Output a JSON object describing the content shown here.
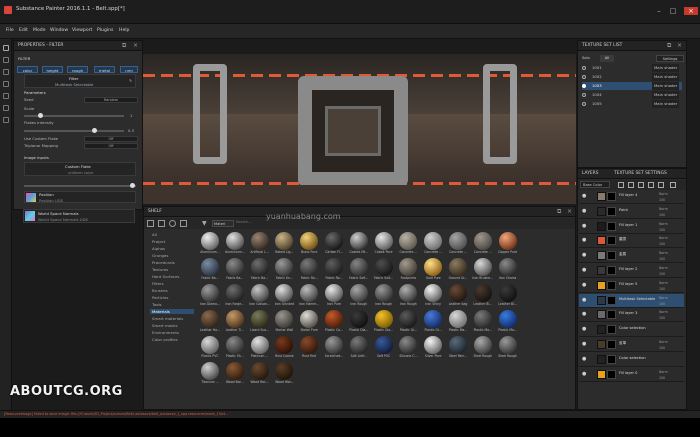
{
  "app": {
    "window_title": "Substance Painter 2016.1.1 - Belt.spp[*]",
    "menu": [
      "File",
      "Edit",
      "Mode",
      "Window",
      "Viewport",
      "Plugins",
      "Help"
    ]
  },
  "properties": {
    "panel_title": "PROPERTIES - FILTER",
    "section_filter": "FILTER",
    "channel_tags": [
      "color",
      "height",
      "rough",
      "metal",
      "nrm"
    ],
    "filter_label": "Filter",
    "filter_name": "Multitask Selectable",
    "parameters_header": "Parameters",
    "seed_label": "Seed",
    "seed_value": "Random",
    "scale_label": "Scale",
    "scale_value": "1",
    "flakes_label": "Flakes Intensity",
    "flakes_value": "0.3",
    "use_custom_flake_label": "Use Custom Flake",
    "use_custom_flake_value": "Off",
    "triplanar_label": "Triplanar Mapping",
    "triplanar_value": "Off",
    "image_inputs_header": "Image inputs",
    "custom_flake_title": "Custom Flake",
    "custom_flake_sub": "uniform color",
    "position_title": "Position",
    "position_sub": "Position UDS",
    "world_normals_title": "World Space Normals",
    "world_normals_sub": "World Space Normals UDS"
  },
  "shelf": {
    "panel_title": "SHELF",
    "search_placeholder": "Search...",
    "filter_chip": "Materi",
    "categories": [
      "All",
      "Project",
      "Alphas",
      "Grunges",
      "Procedurals",
      "Textures",
      "Hard Surfaces",
      "Filters",
      "Brushes",
      "Particles",
      "Tools",
      "Materials",
      "Smart materials",
      "Smart masks",
      "Environments",
      "Color profiles"
    ],
    "selected_category": "Materials",
    "materials": [
      {
        "name": "Aluminium...",
        "c1": "#f0f0f0",
        "c2": "#5a5a5a"
      },
      {
        "name": "Aluminium...",
        "c1": "#e2e2e2",
        "c2": "#4a4a4a"
      },
      {
        "name": "Artificial L...",
        "c1": "#9a8470",
        "c2": "#2e241d"
      },
      {
        "name": "Baked Lig...",
        "c1": "#c9b58a",
        "c2": "#4a3c25"
      },
      {
        "name": "Brass Pure",
        "c1": "#f4d27a",
        "c2": "#6a4a12"
      },
      {
        "name": "Carbon Fi...",
        "c1": "#6a6a6a",
        "c2": "#121212"
      },
      {
        "name": "Coated Mt...",
        "c1": "#cfcfcf",
        "c2": "#2c2c2c"
      },
      {
        "name": "Cobalt Pure",
        "c1": "#e6e6e6",
        "c2": "#555"
      },
      {
        "name": "Concrete ...",
        "c1": "#b9b2a6",
        "c2": "#59534a"
      },
      {
        "name": "Concrete ...",
        "c1": "#d0d0d0",
        "c2": "#6a6a6a"
      },
      {
        "name": "Concrete ...",
        "c1": "#a6a6a6",
        "c2": "#4a4a4a"
      },
      {
        "name": "Concrete ...",
        "c1": "#9e9890",
        "c2": "#4a453f"
      },
      {
        "name": "Copper Pure",
        "c1": "#f2a77a",
        "c2": "#6a2e12"
      },
      {
        "name": "Fabric Ba...",
        "c1": "#7a8ca3",
        "c2": "#26303d"
      },
      {
        "name": "Fabric Ba...",
        "c1": "#8b8b8b",
        "c2": "#2a2a2a"
      },
      {
        "name": "Fabric Ba...",
        "c1": "#6e6e6e",
        "c2": "#1e1e1e"
      },
      {
        "name": "Fabric Kn...",
        "c1": "#9a9a9a",
        "c2": "#303030"
      },
      {
        "name": "Fabric Ro...",
        "c1": "#7a7a7a",
        "c2": "#262626"
      },
      {
        "name": "Fabric Ro...",
        "c1": "#5e5e5e",
        "c2": "#1a1a1a"
      },
      {
        "name": "Fabric Soft...",
        "c1": "#858585",
        "c2": "#2a2a2a"
      },
      {
        "name": "Fabric Suit...",
        "c1": "#4e4e4e",
        "c2": "#141414"
      },
      {
        "name": "Footprints",
        "c1": "#a29a8d",
        "c2": "#3e3a33"
      },
      {
        "name": "Gold Pure",
        "c1": "#ffe08a",
        "c2": "#8a5a10"
      },
      {
        "name": "Ground Gr...",
        "c1": "#8c7a60",
        "c2": "#332a1c"
      },
      {
        "name": "Iron Brushe...",
        "c1": "#d8d8d8",
        "c2": "#4a4a4a"
      },
      {
        "name": "Iron Chains",
        "c1": "#8a8a8a",
        "c2": "#262626"
      },
      {
        "name": "Iron Diamo...",
        "c1": "#9c9c9c",
        "c2": "#2e2e2e"
      },
      {
        "name": "Iron Forge...",
        "c1": "#6e6e6e",
        "c2": "#1c1c1c"
      },
      {
        "name": "Iron Galvan...",
        "c1": "#c6c6c6",
        "c2": "#3c3c3c"
      },
      {
        "name": "Iron Grinded",
        "c1": "#e0e0e0",
        "c2": "#4a4a4a"
      },
      {
        "name": "Iron Hamm...",
        "c1": "#bdbdbd",
        "c2": "#3a3a3a"
      },
      {
        "name": "Iron Pure",
        "c1": "#e8e8e8",
        "c2": "#505050"
      },
      {
        "name": "Iron Rough",
        "c1": "#a8a8a8",
        "c2": "#353535"
      },
      {
        "name": "Iron Rough",
        "c1": "#9a9a9a",
        "c2": "#2c2c2c"
      },
      {
        "name": "Iron Rough",
        "c1": "#b0b0b0",
        "c2": "#333"
      },
      {
        "name": "Iron Shiny",
        "c1": "#f5f5f5",
        "c2": "#555"
      },
      {
        "name": "Leather bag",
        "c1": "#6a4a36",
        "c2": "#1e140e"
      },
      {
        "name": "Leather Bi...",
        "c1": "#4a3a30",
        "c2": "#15100c"
      },
      {
        "name": "Leather Bl...",
        "c1": "#3a3a3a",
        "c2": "#0f0f0f"
      },
      {
        "name": "Leather Ha...",
        "c1": "#8a6a4e",
        "c2": "#2e2014"
      },
      {
        "name": "Leather Ti...",
        "c1": "#c49a6a",
        "c2": "#4a3018"
      },
      {
        "name": "Lizard Sca...",
        "c1": "#7a7a5a",
        "c2": "#262616"
      },
      {
        "name": "Mortar Wall",
        "c1": "#9a968e",
        "c2": "#3a3733"
      },
      {
        "name": "Nickel Pure",
        "c1": "#e0ddd6",
        "c2": "#4a4740"
      },
      {
        "name": "Plastic Ca...",
        "c1": "#c45a2a",
        "c2": "#4a1a08"
      },
      {
        "name": "Plastic Dia...",
        "c1": "#3a3a3a",
        "c2": "#0e0e0e"
      },
      {
        "name": "Plastic Gla...",
        "c1": "#f2c22a",
        "c2": "#7a5a00"
      },
      {
        "name": "Plastic Gr...",
        "c1": "#5a5a5a",
        "c2": "#151515"
      },
      {
        "name": "Plastic Gr...",
        "c1": "#4a7ad8",
        "c2": "#102a66"
      },
      {
        "name": "Plastic Ma...",
        "c1": "#d8d8d8",
        "c2": "#6a6a6a"
      },
      {
        "name": "Plastic Mo...",
        "c1": "#7a7a7a",
        "c2": "#262626"
      },
      {
        "name": "Plastic Ma...",
        "c1": "#3a7ae0",
        "c2": "#0e2a66"
      },
      {
        "name": "Plastic PVC",
        "c1": "#dadada",
        "c2": "#5a5a5a"
      },
      {
        "name": "Plastic Sh...",
        "c1": "#8a8a8a",
        "c2": "#2a2a2a"
      },
      {
        "name": "Platinum ...",
        "c1": "#e4e4e4",
        "c2": "#5a5a5a"
      },
      {
        "name": "Rust Coarse",
        "c1": "#7a3a1e",
        "c2": "#2a0e06"
      },
      {
        "name": "Rust Fine",
        "c1": "#8a4a2a",
        "c2": "#2e140a"
      },
      {
        "name": "Scratched...",
        "c1": "#9a9a9a",
        "c2": "#2e2e2e"
      },
      {
        "name": "Soft Artif...",
        "c1": "#7a7a7a",
        "c2": "#222"
      },
      {
        "name": "Soft PVC",
        "c1": "#3a5a9a",
        "c2": "#0e1a36"
      },
      {
        "name": "Silicone C...",
        "c1": "#8a8a8a",
        "c2": "#262626"
      },
      {
        "name": "Silver Pure",
        "c1": "#f4f4f4",
        "c2": "#5e5e5e"
      },
      {
        "name": "Steel Pain...",
        "c1": "#5a6a7a",
        "c2": "#1a222a"
      },
      {
        "name": "Steel Rough",
        "c1": "#aaaaaa",
        "c2": "#363636"
      },
      {
        "name": "Steel Rough",
        "c1": "#9a9a9a",
        "c2": "#2e2e2e"
      },
      {
        "name": "Titanium ...",
        "c1": "#cfcfcf",
        "c2": "#444"
      },
      {
        "name": "Wood Bar...",
        "c1": "#8a5a36",
        "c2": "#2e1a0c"
      },
      {
        "name": "Wood Roc...",
        "c1": "#6a4a2e",
        "c2": "#22160c"
      },
      {
        "name": "Wood Wor...",
        "c1": "#5a3e26",
        "c2": "#1c1208"
      }
    ]
  },
  "texture_set_list": {
    "panel_title": "TEXTURE SET LIST",
    "solo_label": "Solo",
    "all_label": "All",
    "settings_label": "Settings",
    "rows": [
      {
        "name": "1001",
        "shader": "Main shader"
      },
      {
        "name": "1002",
        "shader": "Main shader"
      },
      {
        "name": "1003",
        "shader": "Main shader"
      },
      {
        "name": "1004",
        "shader": "Main shader"
      },
      {
        "name": "1005",
        "shader": "Main shader"
      }
    ]
  },
  "layers": {
    "tab_layers": "LAYERS",
    "tab_tss": "TEXTURE SET SETTINGS",
    "channel_select": "Base Color",
    "items": [
      {
        "name": "Fill layer 4",
        "blend": "Norm",
        "opacity": "100",
        "thumb": "#8a7a6a"
      },
      {
        "name": "Paint",
        "blend": "Norm",
        "opacity": "100",
        "thumb": "#2a2a2a"
      },
      {
        "name": "Fill layer 1",
        "blend": "Norm",
        "opacity": "100",
        "thumb": "#1c1c1c"
      },
      {
        "name": "磨损",
        "blend": "Norm",
        "opacity": "100",
        "thumb": "#d85a3a"
      },
      {
        "name": "金属",
        "blend": "Norm",
        "opacity": "100",
        "thumb": "#7a7a7a"
      },
      {
        "name": "Fill layer 2",
        "blend": "Norm",
        "opacity": "100",
        "thumb": "#3a3a3a"
      },
      {
        "name": "Fill layer 5",
        "blend": "Norm",
        "opacity": "100",
        "thumb": "#e8a020"
      },
      {
        "name": "Multitask Selectable",
        "blend": "Norm",
        "opacity": "100",
        "thumb": "#2a3a4a"
      },
      {
        "name": "Fill layer 3",
        "blend": "Norm",
        "opacity": "100",
        "thumb": "#6a6a6a"
      },
      {
        "name": "Color selection",
        "blend": "",
        "opacity": "",
        "thumb": "#222"
      },
      {
        "name": "皮革",
        "blend": "Norm",
        "opacity": "100",
        "thumb": "#4a3a2a"
      },
      {
        "name": "Color selection",
        "blend": "",
        "opacity": "",
        "thumb": "#222"
      },
      {
        "name": "Fill layer 0",
        "blend": "Norm",
        "opacity": "100",
        "thumb": "#e8a020"
      }
    ]
  },
  "status": "[ResourceImage] Failed to save image: file:///F:/work/SD_Project/scenes/Belt/.autosave/belt_autosave_1_spp.resources/mask_15e4...",
  "watermark": {
    "site": "yuanhuabang.com",
    "logo": "ABOUTCG.ORG"
  },
  "colors": {
    "accent": "#3d7ab8",
    "selected_row": "#2f4f72",
    "status_error": "#e05a3a"
  }
}
